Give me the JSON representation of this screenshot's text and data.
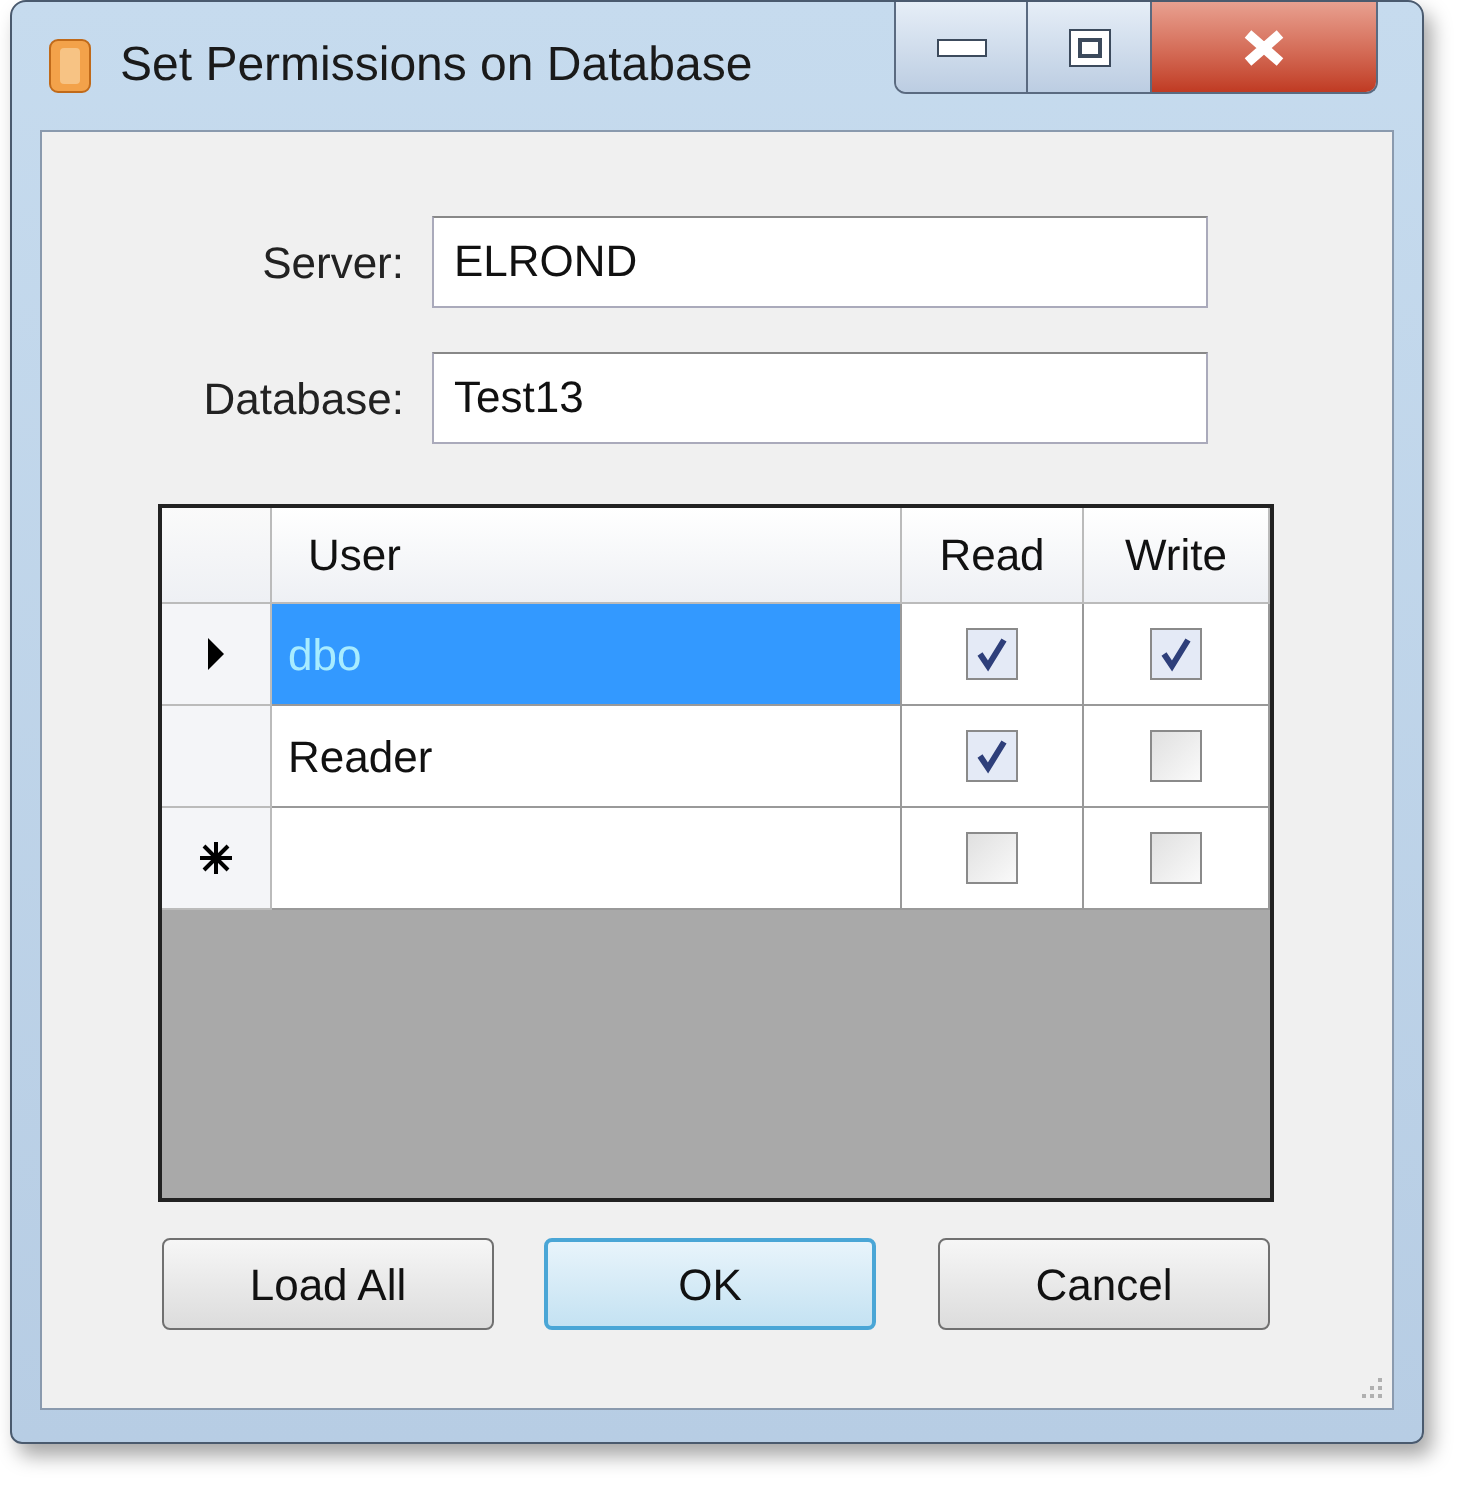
{
  "window": {
    "title": "Set Permissions on Database"
  },
  "fields": [
    {
      "label": "Server:",
      "value": "ELROND"
    },
    {
      "label": "Database:",
      "value": "Test13"
    }
  ],
  "grid": {
    "columns": [
      "User",
      "Read",
      "Write"
    ],
    "rows": [
      {
        "kind": "current",
        "user": "dbo",
        "selected": true,
        "read": true,
        "write": true
      },
      {
        "kind": "plain",
        "user": "Reader",
        "selected": false,
        "read": true,
        "write": false
      },
      {
        "kind": "new",
        "selected": false,
        "read": false,
        "write": false
      }
    ]
  },
  "buttons": [
    {
      "label": "Load All",
      "default": false
    },
    {
      "label": "OK",
      "default": true
    },
    {
      "label": "Cancel",
      "default": false
    }
  ]
}
